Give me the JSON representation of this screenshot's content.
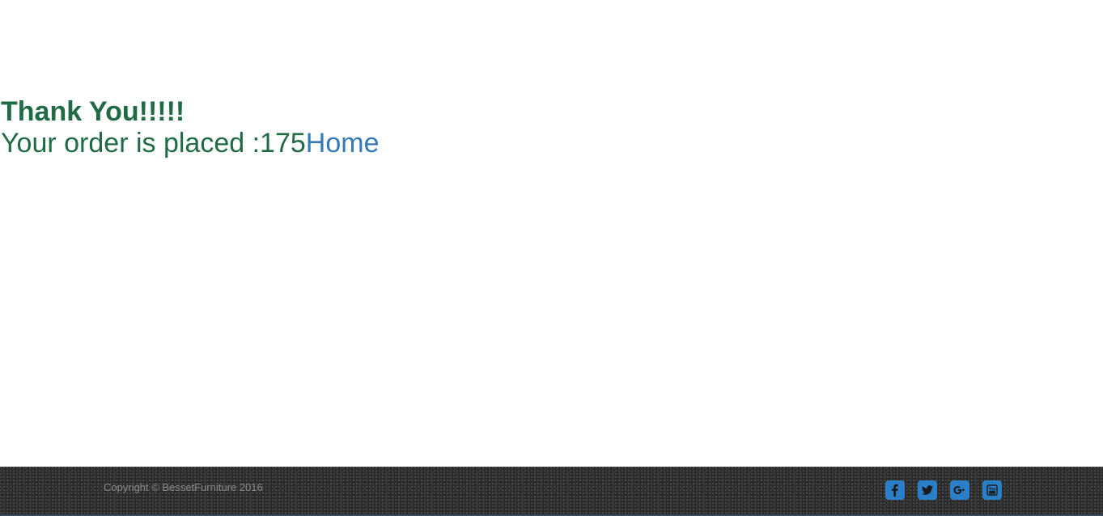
{
  "main": {
    "heading": "Thank You!!!!!",
    "order_text": "Your order is placed :175",
    "home_link": "Home"
  },
  "footer": {
    "copyright": "Copyright © BessetFurniture 2016",
    "social_icons": [
      "facebook-icon",
      "twitter-icon",
      "google-plus-icon",
      "youtube-icon"
    ]
  },
  "colors": {
    "text_green": "#1f6b45",
    "link_blue": "#337ab7",
    "footer_bg": "#2b2b2b",
    "social_blue": "#2a7fc6"
  }
}
